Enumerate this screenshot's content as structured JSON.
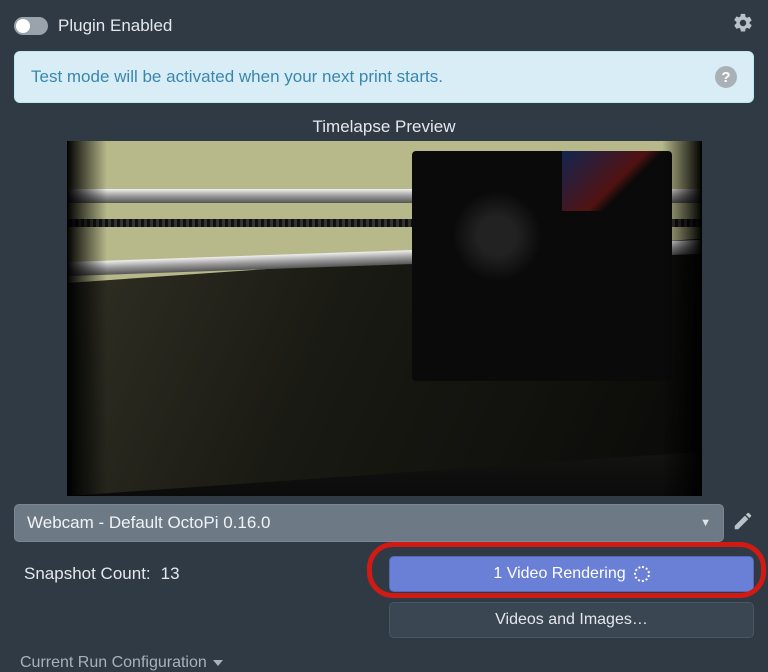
{
  "header": {
    "plugin_label": "Plugin Enabled"
  },
  "banner": {
    "message": "Test mode will be activated when your next print starts."
  },
  "preview": {
    "title": "Timelapse Preview"
  },
  "camera_select": {
    "selected": "Webcam - Default OctoPi 0.16.0"
  },
  "snapshot": {
    "label": "Snapshot Count:",
    "value": "13"
  },
  "buttons": {
    "rendering": "1 Video Rendering",
    "videos_images": "Videos and Images…"
  },
  "run_config": {
    "label": "Current Run Configuration"
  }
}
